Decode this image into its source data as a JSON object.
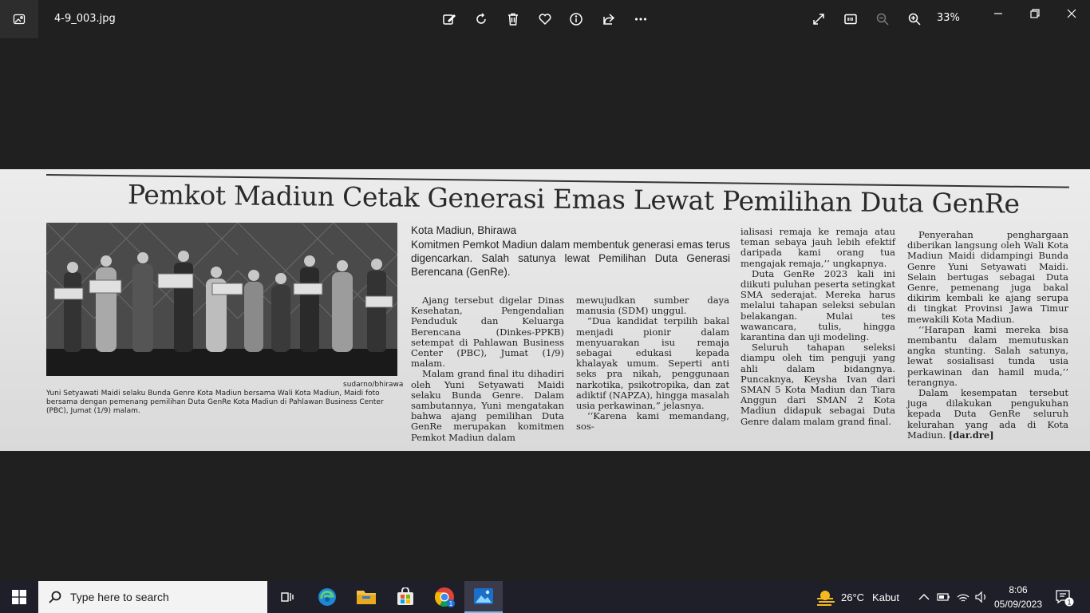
{
  "window": {
    "filename": "4-9_003.jpg",
    "zoom": "33%",
    "toolbar_icons": [
      "edit-image-icon",
      "rotate-icon",
      "delete-icon",
      "favorite-icon",
      "info-icon",
      "share-icon",
      "more-icon"
    ],
    "view_icons": [
      "fullscreen-icon",
      "actual-size-icon",
      "zoom-out-icon",
      "zoom-in-icon"
    ]
  },
  "article": {
    "headline": "Pemkot Madiun Cetak Generasi Emas Lewat Pemilihan Duta GenRe",
    "location": "Kota Madiun, Bhirawa",
    "lead": "Komitmen Pemkot Madiun dalam membentuk generasi emas terus digencarkan. Salah satunya lewat Pemilihan Duta Generasi Berencana (GenRe).",
    "photo_credit": "sudarno/bhirawa",
    "caption": "Yuni Setyawati Maidi selaku Bunda Genre Kota Madiun bersama Wali Kota Madiun, Maidi foto bersama dengan pemenang pemilihan Duta GenRe Kota Madiun di Pahlawan Business Center (PBC), Jumat (1/9) malam.",
    "col1_p1": "Ajang tersebut digelar Dinas Kesehatan, Pengendalian Penduduk dan Keluarga Berencana (Dinkes-PPKB) setempat di Pahlawan Business Center (PBC), Jumat (1/9) malam.",
    "col1_p2": "Malam grand final itu dihadiri oleh Yuni Setyawati Maidi selaku Bunda Genre. Dalam sambutannya, Yuni mengatakan bahwa ajang pemilihan Duta GenRe merupakan komitmen Pemkot Madiun dalam",
    "col2_p1": "mewujudkan sumber daya manusia (SDM) unggul.",
    "col2_p2": "“Dua kandidat terpilih bakal menjadi pionir dalam menyuarakan isu remaja sebagai edukasi kepada khalayak umum. Seperti anti seks pra nikah, penggunaan narkotika, psikotropika, dan zat adiktif (NAPZA), hingga masalah usia perkawinan,” jelasnya.",
    "col2_p3": "‘‘Karena kami memandang, sos-",
    "col3_p1": "ialisasi remaja ke remaja atau teman sebaya jauh lebih efektif daripada kami orang tua mengajak remaja,’’ ungkapnya.",
    "col3_p2": "Duta GenRe 2023 kali ini diikuti puluhan peserta setingkat SMA sederajat. Mereka harus melalui tahapan seleksi sebulan belakangan. Mulai tes wawancara, tulis, hingga karantina dan uji modeling.",
    "col3_p3": "Seluruh tahapan seleksi diampu oleh tim penguji yang ahli dalam bidangnya. Puncaknya, Keysha Ivan dari SMAN 5 Kota Madiun dan Tiara Anggun dari SMAN 2 Kota Madiun didapuk sebagai Duta Genre dalam malam grand final.",
    "col4_p1": "Penyerahan penghargaan diberikan langsung oleh Wali Kota Madiun Maidi didampingi Bunda Genre Yuni Setyawati Maidi. Selain bertugas sebagai Duta Genre, pemenang juga bakal dikirim kembali ke ajang serupa di tingkat Provinsi Jawa Timur mewakili Kota Madiun.",
    "col4_p2": "‘‘Harapan kami mereka bisa membantu dalam memutuskan angka stunting. Salah satunya, lewat sosialisasi tunda usia perkawinan dan hamil muda,’’ terangnya.",
    "col4_p3": "Dalam kesempatan tersebut juga dilakukan pengukuhan kepada Duta GenRe seluruh kelurahan yang ada di Kota Madiun.",
    "signature": "[dar.dre]"
  },
  "taskbar": {
    "search_placeholder": "Type here to search",
    "weather_temp": "26°C",
    "weather_desc": "Kabut",
    "time": "8:06",
    "date": "05/09/2023",
    "notification_count": "1",
    "pinned_apps": [
      "task-view-icon",
      "edge-icon",
      "file-explorer-icon",
      "store-icon",
      "chrome-icon",
      "photos-icon"
    ],
    "chrome_badge": "1"
  }
}
